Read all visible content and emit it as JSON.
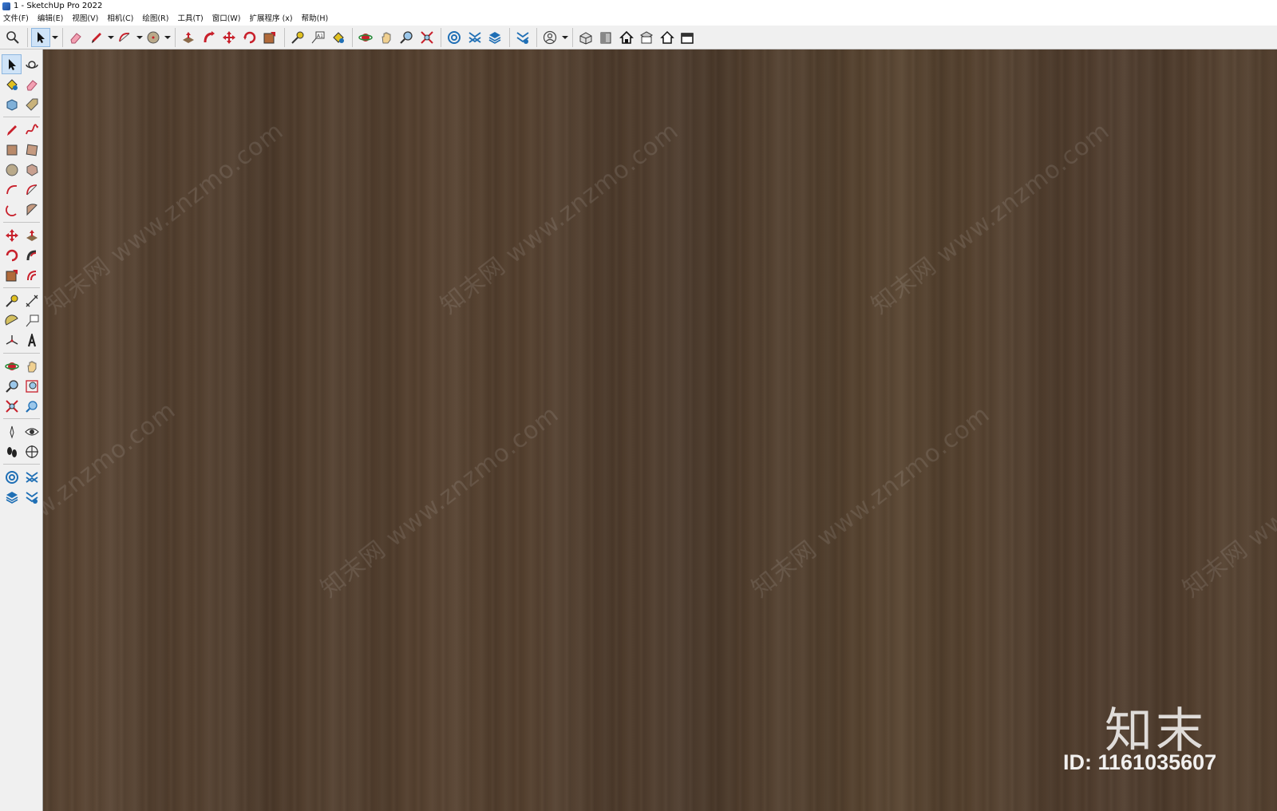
{
  "window": {
    "title": "1 - SketchUp Pro 2022"
  },
  "menu": [
    "文件(F)",
    "编辑(E)",
    "视图(V)",
    "相机(C)",
    "绘图(R)",
    "工具(T)",
    "窗口(W)",
    "扩展程序 (x)",
    "帮助(H)"
  ],
  "toolbar_icons": [
    "search-icon",
    "select-arrow-icon",
    "eraser-icon",
    "pencil-line-icon",
    "arc-icon",
    "circle-icon",
    "push-pull-icon",
    "follow-me-icon",
    "move-icon",
    "rotate-icon",
    "scale-icon",
    "tape-measure-icon",
    "text-label-icon",
    "paint-bucket-icon",
    "orbit-icon",
    "pan-icon",
    "zoom-icon",
    "zoom-extents-icon",
    "warehouse-icon",
    "extensions-icon",
    "layers-icon",
    "layout-icon",
    "account-icon",
    "iso-view-icon",
    "front-view-icon",
    "home-view-icon",
    "top-view-icon",
    "back-view-icon",
    "side-view-icon"
  ],
  "left_toolbar_icons": [
    [
      "select-arrow-icon",
      "orbit-icon"
    ],
    [
      "paint-bucket-icon",
      "eraser-icon"
    ],
    [
      "component-icon",
      "tag-icon"
    ],
    [
      "pencil-line-icon",
      "freehand-icon"
    ],
    [
      "rectangle-icon",
      "rotated-rectangle-icon"
    ],
    [
      "circle-icon",
      "polygon-icon"
    ],
    [
      "arc-icon",
      "two-point-arc-icon"
    ],
    [
      "three-point-arc-icon",
      "pie-icon"
    ],
    [
      "move-icon",
      "push-pull-icon"
    ],
    [
      "rotate-icon",
      "follow-me-icon"
    ],
    [
      "scale-icon",
      "offset-icon"
    ],
    [
      "tape-measure-icon",
      "dimension-icon"
    ],
    [
      "protractor-icon",
      "text-label-icon"
    ],
    [
      "axes-icon",
      "3d-text-icon"
    ],
    [
      "orbit-alt-icon",
      "pan-icon"
    ],
    [
      "zoom-icon",
      "zoom-window-icon"
    ],
    [
      "zoom-extents-icon",
      "previous-view-icon"
    ],
    [
      "position-camera-icon",
      "look-around-icon"
    ],
    [
      "walk-icon",
      "section-plane-icon"
    ],
    [
      "warehouse-icon",
      "extensions-icon"
    ],
    [
      "layers-icon",
      "layout-icon"
    ]
  ],
  "viewport": {
    "watermark_text": "知末网 www.znzmo.com",
    "brand_logo": "知末",
    "brand_id": "ID: 1161035607"
  },
  "colors": {
    "wood_base": "#523f2e",
    "toolbar_bg": "#f0f0f0",
    "active_tool": "#cfe3f7",
    "icon_red": "#c8202b",
    "icon_blue": "#1f6fb5"
  }
}
